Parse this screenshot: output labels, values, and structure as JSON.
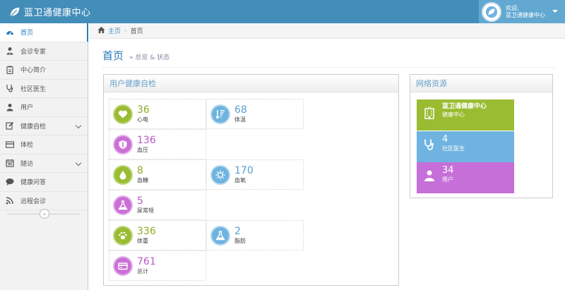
{
  "brand": {
    "title": "蓝卫通健康中心"
  },
  "user": {
    "welcome": "欢迎,",
    "name": "蓝卫通健康中心"
  },
  "sidebar": {
    "items": [
      {
        "label": "首页",
        "icon": "dashboard-icon",
        "active": true
      },
      {
        "label": "会诊专家",
        "icon": "user-md-icon"
      },
      {
        "label": "中心简介",
        "icon": "clipboard-icon"
      },
      {
        "label": "社区医生",
        "icon": "stethoscope-icon"
      },
      {
        "label": "用户",
        "icon": "user-icon"
      },
      {
        "label": "健康自检",
        "icon": "edit-icon",
        "submenu": true
      },
      {
        "label": "体检",
        "icon": "list-icon"
      },
      {
        "label": "随访",
        "icon": "calendar-icon",
        "submenu": true
      },
      {
        "label": "健康问答",
        "icon": "comment-icon"
      },
      {
        "label": "远程会诊",
        "icon": "rss-icon"
      }
    ],
    "collapse_glyph": "«"
  },
  "breadcrumb": {
    "home": "主页",
    "current": "首页"
  },
  "page": {
    "title": "首页",
    "subtitle": "» 总览 & 状态"
  },
  "health_widget": {
    "title": "用户健康自检",
    "stats": [
      {
        "value": "36",
        "label": "心电",
        "color": "green",
        "icon": "heart-icon"
      },
      {
        "value": "68",
        "label": "体温",
        "color": "blue",
        "icon": "sort-amount-icon"
      },
      {
        "value": "136",
        "label": "血压",
        "color": "purple",
        "icon": "shield-icon"
      },
      {
        "value": "8",
        "label": "血糖",
        "color": "green",
        "icon": "drop-icon"
      },
      {
        "value": "170",
        "label": "血氧",
        "color": "blue",
        "icon": "sun-icon"
      },
      {
        "value": "5",
        "label": "尿常规",
        "color": "purple",
        "icon": "flask-icon"
      },
      {
        "value": "336",
        "label": "体重",
        "color": "green",
        "icon": "paw-icon"
      },
      {
        "value": "2",
        "label": "脂肪",
        "color": "blue",
        "icon": "flask-icon"
      },
      {
        "value": "761",
        "label": "总计",
        "color": "purple",
        "icon": "credit-card-icon"
      }
    ]
  },
  "network_widget": {
    "title": "网络资源",
    "tiles": [
      {
        "value": "蓝卫通健康中心",
        "label": "健康中心",
        "color": "#9abc32",
        "icon": "hospital-icon"
      },
      {
        "value": "4",
        "label": "社区医生",
        "color": "#6fb3e0",
        "icon": "stethoscope-icon"
      },
      {
        "value": "34",
        "label": "用户",
        "color": "#c66fd8",
        "icon": "user-icon"
      }
    ]
  },
  "colors": {
    "navbar": "#438eb9",
    "accent": "#2679b5",
    "green": "#9abc32",
    "blue": "#6fb3e0",
    "purple": "#cb6fd7"
  }
}
